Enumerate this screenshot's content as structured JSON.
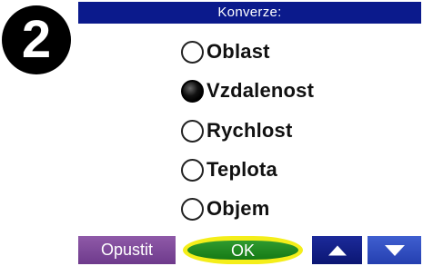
{
  "step": {
    "number": "2"
  },
  "dialog": {
    "title": "Konverze:",
    "options": [
      {
        "label": "Oblast",
        "selected": false
      },
      {
        "label": "Vzdalenost",
        "selected": true
      },
      {
        "label": "Rychlost",
        "selected": false
      },
      {
        "label": "Teplota",
        "selected": false
      },
      {
        "label": "Objem",
        "selected": false
      }
    ]
  },
  "toolbar": {
    "cancel_label": "Opustit",
    "ok_label": "OK",
    "up_icon": "up-arrow-icon",
    "down_icon": "down-arrow-icon"
  },
  "colors": {
    "title_bar": "#0b1a8c",
    "cancel_button": "#7a4597",
    "ok_button": "#1f8a1f",
    "ok_highlight": "#f4ee1a",
    "up_button": "#13208a",
    "down_button": "#3352c4"
  }
}
